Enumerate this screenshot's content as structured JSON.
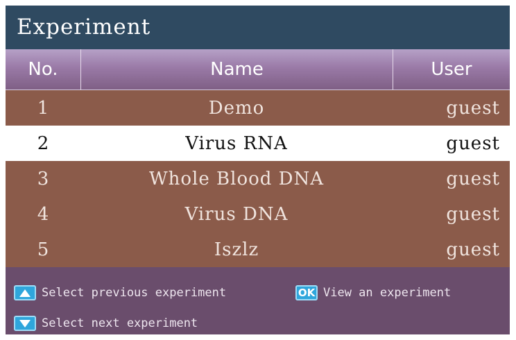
{
  "window": {
    "title": "Experiment"
  },
  "table": {
    "headers": {
      "no": "No.",
      "name": "Name",
      "user": "User"
    },
    "rows": [
      {
        "no": "1",
        "name": "Demo",
        "user": "guest"
      },
      {
        "no": "2",
        "name": "Virus RNA",
        "user": "guest"
      },
      {
        "no": "3",
        "name": "Whole Blood DNA",
        "user": "guest"
      },
      {
        "no": "4",
        "name": "Virus DNA",
        "user": "guest"
      },
      {
        "no": "5",
        "name": "Iszlz",
        "user": "guest"
      }
    ],
    "selected_no": "2"
  },
  "hints": {
    "prev_label": "Select previous experiment",
    "ok_key": "OK",
    "ok_label": "View an experiment",
    "next_label": "Select next experiment",
    "prev_icon": "arrow-up-icon",
    "next_icon": "arrow-down-icon"
  },
  "colors": {
    "title_bar": "#2f4a61",
    "row_bg": "#8b5b4a",
    "row_selected_bg": "#ffffff",
    "hint_bg": "#6a4d6c",
    "key_bg": "#2fa6dc"
  }
}
